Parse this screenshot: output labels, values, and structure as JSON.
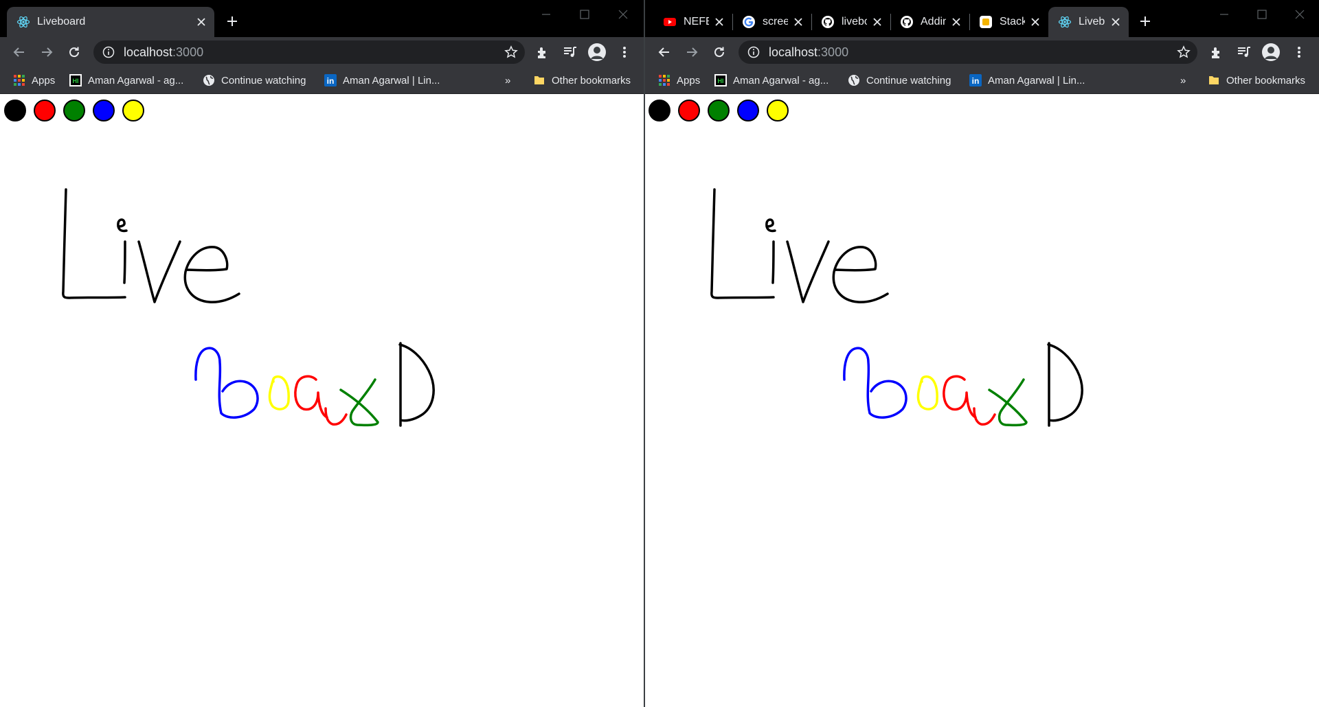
{
  "left": {
    "tabs": [
      {
        "title": "Liveboard",
        "icon": "react-icon"
      }
    ],
    "url_host": "localhost",
    "url_port": ":3000"
  },
  "right": {
    "tabs": [
      {
        "title": "NEFE",
        "icon": "youtube-icon"
      },
      {
        "title": "scree",
        "icon": "google-icon"
      },
      {
        "title": "livebo",
        "icon": "github-icon"
      },
      {
        "title": "Addin",
        "icon": "github-icon"
      },
      {
        "title": "Stack",
        "icon": "stackblitz-icon"
      },
      {
        "title": "Liveb",
        "icon": "react-icon"
      }
    ],
    "url_host": "localhost",
    "url_port": ":3000"
  },
  "bookmarks": {
    "apps": "Apps",
    "item1": "Aman Agarwal - ag...",
    "item2": "Continue watching",
    "item3": "Aman Agarwal | Lin...",
    "overflow": "»",
    "other": "Other bookmarks"
  },
  "palette": [
    {
      "name": "black",
      "color": "#000000"
    },
    {
      "name": "red",
      "color": "#ff0000"
    },
    {
      "name": "green",
      "color": "#008000"
    },
    {
      "name": "blue",
      "color": "#0000ff"
    },
    {
      "name": "yellow",
      "color": "#ffff00"
    }
  ],
  "colors": {
    "tab_strip": "#000000",
    "toolbar": "#35363a",
    "omnibox": "#202124",
    "canvas": "#ffffff"
  }
}
